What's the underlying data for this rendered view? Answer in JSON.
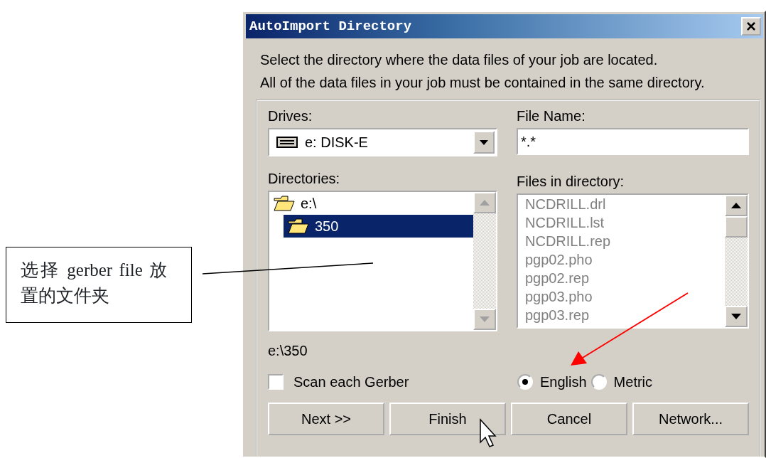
{
  "annotation": {
    "text": "选择 gerber file 放置的文件夹"
  },
  "window": {
    "title": "AutoImport Directory",
    "close": "×"
  },
  "instructions": [
    "Select the directory where the data files of your job are located.",
    "All of the data files in your job must be contained in the same directory."
  ],
  "drives": {
    "label": "Drives:",
    "value": "e: DISK-E"
  },
  "file_name": {
    "label": "File Name:",
    "value": "*.*"
  },
  "directories": {
    "label": "Directories:",
    "items": [
      {
        "label": "e:\\",
        "selected": false,
        "children": [
          {
            "label": "350",
            "selected": true
          }
        ]
      }
    ]
  },
  "files": {
    "label": "Files in directory:",
    "items": [
      "NCDRILL.drl",
      "NCDRILL.lst",
      "NCDRILL.rep",
      "pgp02.pho",
      "pgp02.rep",
      "pgp03.pho",
      "pgp03.rep"
    ]
  },
  "current_path": "e:\\350",
  "scan_each_gerber": {
    "label": "Scan each Gerber",
    "checked": false
  },
  "units": [
    {
      "label": "English",
      "selected": true
    },
    {
      "label": "Metric",
      "selected": false
    }
  ],
  "buttons": [
    "Next >>",
    "Finish",
    "Cancel",
    "Network..."
  ]
}
